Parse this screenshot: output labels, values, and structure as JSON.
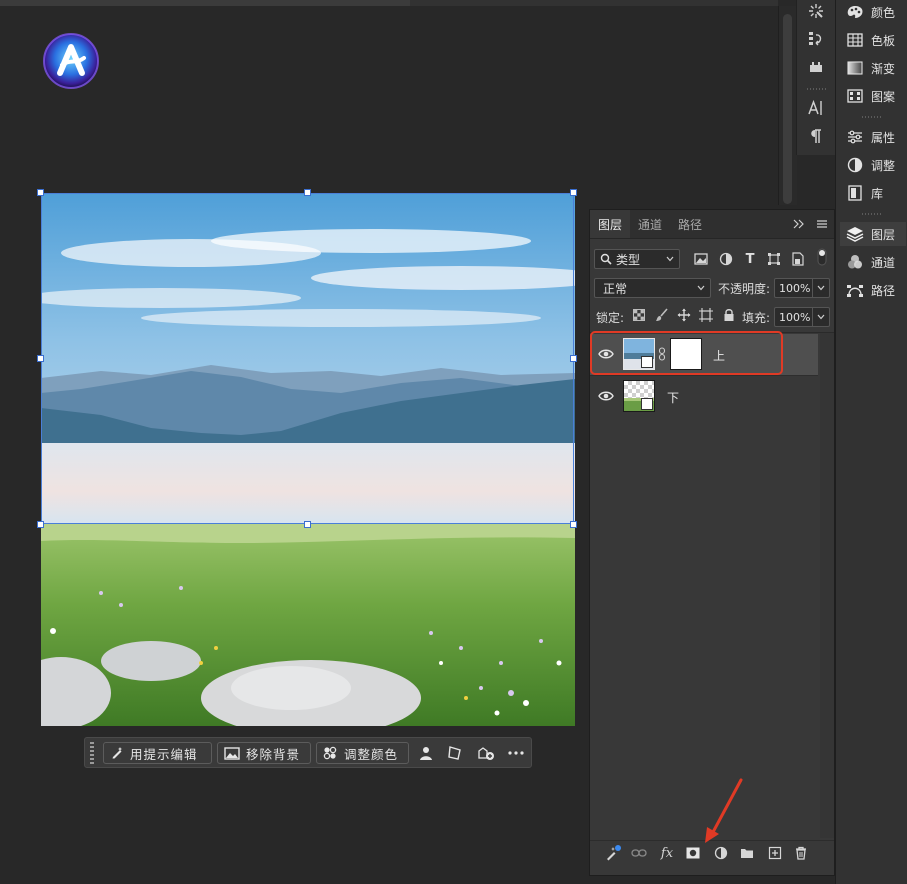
{
  "taskbar": {
    "prompt_edit_label": "用提示编辑",
    "remove_bg_label": "移除背景",
    "adjust_color_label": "调整颜色"
  },
  "right_dock": {
    "items": [
      {
        "label": "颜色",
        "icon": "color-palette-icon"
      },
      {
        "label": "色板",
        "icon": "swatches-grid-icon"
      },
      {
        "label": "渐变",
        "icon": "gradient-icon"
      },
      {
        "label": "图案",
        "icon": "pattern-icon"
      },
      {
        "label": "属性",
        "icon": "properties-sliders-icon"
      },
      {
        "label": "调整",
        "icon": "adjustments-icon"
      },
      {
        "label": "库",
        "icon": "library-icon"
      },
      {
        "label": "图层",
        "icon": "layers-icon"
      },
      {
        "label": "通道",
        "icon": "channels-icon"
      },
      {
        "label": "路径",
        "icon": "paths-icon"
      }
    ]
  },
  "layers_panel": {
    "tabs": [
      "图层",
      "通道",
      "路径"
    ],
    "filter_kind": "类型",
    "blend_mode": "正常",
    "opacity_label": "不透明度:",
    "opacity_value": "100%",
    "lock_label": "锁定:",
    "fill_label": "填充:",
    "fill_value": "100%",
    "layers": [
      {
        "name": "上",
        "selected": true,
        "has_mask": true,
        "visible": true
      },
      {
        "name": "下",
        "selected": false,
        "has_mask": false,
        "visible": true
      }
    ]
  },
  "colors": {
    "selection_outline": "#e03a25",
    "annotation_arrow": "#e03a25",
    "transform_box": "#4a7fd8"
  }
}
